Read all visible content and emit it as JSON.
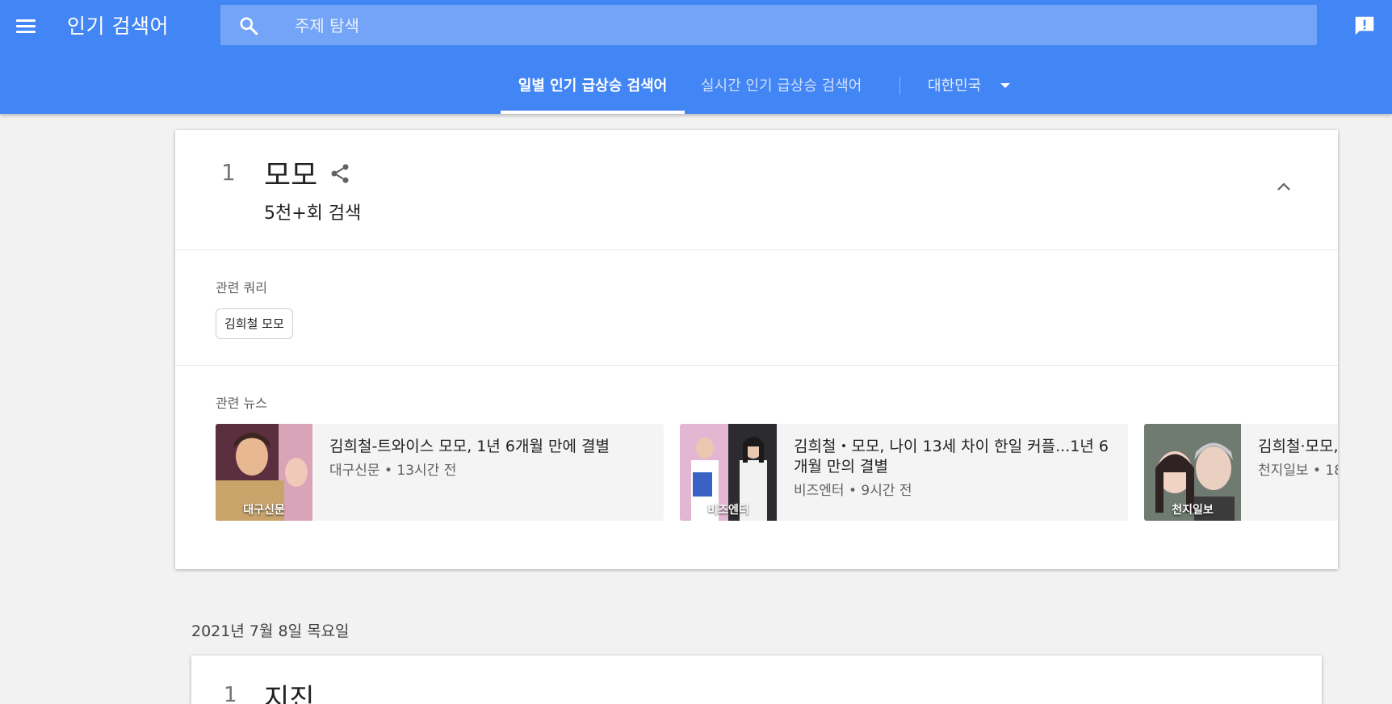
{
  "header": {
    "title": "인기 검색어",
    "search_placeholder": "주제 탐색",
    "tabs": [
      {
        "label": "일별 인기 급상승 검색어",
        "active": true
      },
      {
        "label": "실시간 인기 급상승 검색어",
        "active": false
      }
    ],
    "country": "대한민국",
    "colors": {
      "bar": "#4285f4",
      "search_box": "#73a4f7"
    }
  },
  "trend": {
    "rank": "1",
    "term": "모모",
    "search_count": "5천+회 검색",
    "related_queries_label": "관련 쿼리",
    "related_queries": [
      "김희철 모모"
    ],
    "related_news_label": "관련 뉴스",
    "news": [
      {
        "title": "김희철-트와이스 모모, 1년 6개월 만에 결별",
        "source": "대구신문",
        "time": "13시간 전",
        "meta": "대구신문 • 13시간 전"
      },
      {
        "title": "김희철・모모, 나이 13세 차이 한일 커플...1년 6개월 만의 결별",
        "source": "비즈엔터",
        "time": "9시간 전",
        "meta": "비즈엔터 • 9시간 전"
      },
      {
        "title": "김희철·모모, 나이",
        "source": "천지일보",
        "time": "18",
        "meta": "천지일보 • 18"
      }
    ]
  },
  "date_heading": "2021년 7월 8일 목요일",
  "next_trend": {
    "term": "지진",
    "rank": "1"
  }
}
